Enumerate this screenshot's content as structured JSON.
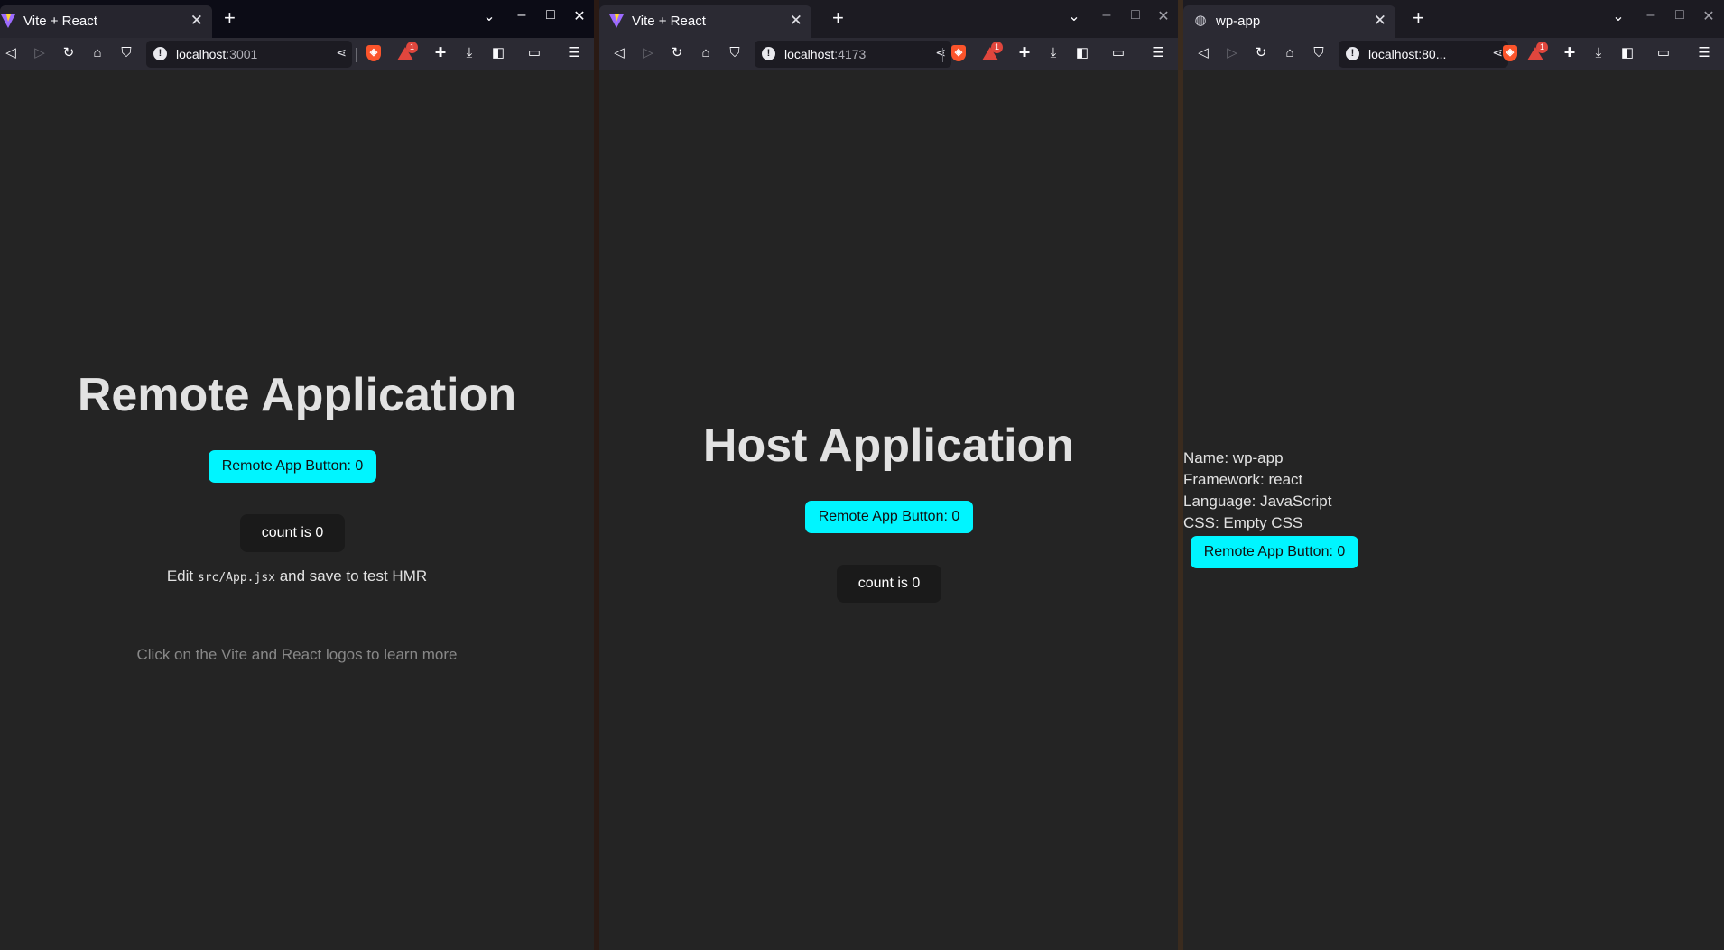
{
  "windows": [
    {
      "tab_title": "Vite + React",
      "url_host": "localhost",
      "url_port": ":3001",
      "heading": "Remote Application",
      "remote_button": "Remote App Button: 0",
      "count_button": "count is 0",
      "hmr_prefix": "Edit ",
      "hmr_code": "src/App.jsx",
      "hmr_suffix": " and save to test HMR",
      "docs_text": "Click on the Vite and React logos to learn more"
    },
    {
      "tab_title": "Vite + React",
      "url_host": "localhost",
      "url_port": ":4173",
      "heading": "Host Application",
      "remote_button": "Remote App Button: 0",
      "count_button": "count is 0"
    },
    {
      "tab_title": "wp-app",
      "url_text": "localhost:80...",
      "info_lines": [
        "Name: wp-app",
        "Framework: react",
        "Language: JavaScript",
        "CSS: Empty CSS"
      ],
      "remote_button": "Remote App Button: 0"
    }
  ],
  "brave_badge_count": "1",
  "colors": {
    "accent_button": "#00f5ff",
    "page_bg": "#242424",
    "tab_bar": "#2b2a33"
  }
}
